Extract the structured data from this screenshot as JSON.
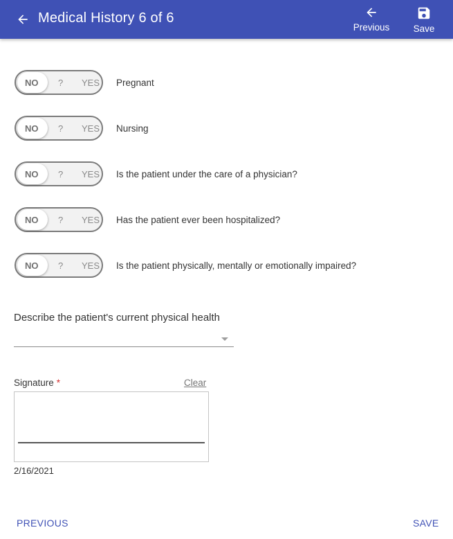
{
  "appbar": {
    "title": "Medical History 6 of 6",
    "previous_label": "Previous",
    "save_label": "Save",
    "color": "#3f51b5"
  },
  "toggle_options": {
    "no": "NO",
    "unknown": "?",
    "yes": "YES"
  },
  "questions": [
    {
      "label": "Pregnant",
      "value": "NO"
    },
    {
      "label": "Nursing",
      "value": "NO"
    },
    {
      "label": "Is the patient under the care of a physician?",
      "value": "NO"
    },
    {
      "label": "Has the patient ever been hospitalized?",
      "value": "NO"
    },
    {
      "label": "Is the patient physically, mentally or emotionally impaired?",
      "value": "NO"
    }
  ],
  "physical_health": {
    "label": "Describe the patient's current physical health",
    "value": ""
  },
  "signature": {
    "label": "Signature",
    "required_marker": "*",
    "clear_label": "Clear",
    "date": "2/16/2021"
  },
  "footer": {
    "previous_label": "PREVIOUS",
    "save_label": "SAVE"
  }
}
